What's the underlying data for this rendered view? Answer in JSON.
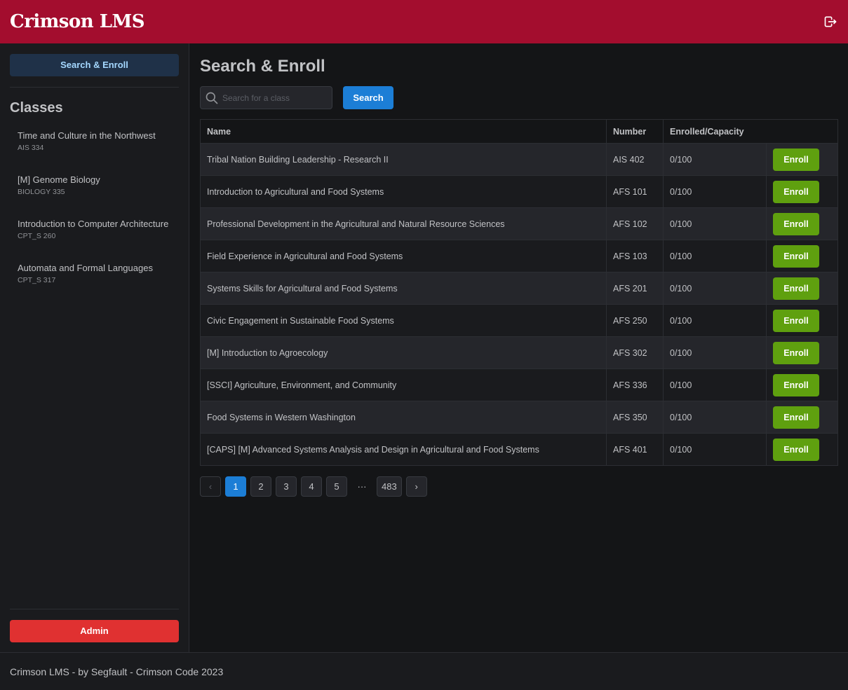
{
  "header": {
    "brand": "Crimson LMS",
    "logout_icon": "logout-icon"
  },
  "sidebar": {
    "nav_button": "Search & Enroll",
    "classes_title": "Classes",
    "classes": [
      {
        "name": "Time and Culture in the Northwest",
        "code": "AIS 334"
      },
      {
        "name": "[M] Genome Biology",
        "code": "BIOLOGY 335"
      },
      {
        "name": "Introduction to Computer Architecture",
        "code": "CPT_S 260"
      },
      {
        "name": "Automata and Formal Languages",
        "code": "CPT_S 317"
      }
    ],
    "admin_button": "Admin"
  },
  "main": {
    "title": "Search & Enroll",
    "search": {
      "placeholder": "Search for a class",
      "value": "",
      "button": "Search"
    },
    "table": {
      "headers": {
        "name": "Name",
        "number": "Number",
        "capacity": "Enrolled/Capacity"
      },
      "enroll_label": "Enroll",
      "rows": [
        {
          "name": "Tribal Nation Building Leadership - Research II",
          "number": "AIS 402",
          "capacity": "0/100"
        },
        {
          "name": "Introduction to Agricultural and Food Systems",
          "number": "AFS 101",
          "capacity": "0/100"
        },
        {
          "name": "Professional Development in the Agricultural and Natural Resource Sciences",
          "number": "AFS 102",
          "capacity": "0/100"
        },
        {
          "name": "Field Experience in Agricultural and Food Systems",
          "number": "AFS 103",
          "capacity": "0/100"
        },
        {
          "name": "Systems Skills for Agricultural and Food Systems",
          "number": "AFS 201",
          "capacity": "0/100"
        },
        {
          "name": "Civic Engagement in Sustainable Food Systems",
          "number": "AFS 250",
          "capacity": "0/100"
        },
        {
          "name": "[M] Introduction to Agroecology",
          "number": "AFS 302",
          "capacity": "0/100"
        },
        {
          "name": "[SSCI] Agriculture, Environment, and Community",
          "number": "AFS 336",
          "capacity": "0/100"
        },
        {
          "name": "Food Systems in Western Washington",
          "number": "AFS 350",
          "capacity": "0/100"
        },
        {
          "name": "[CAPS] [M] Advanced Systems Analysis and Design in Agricultural and Food Systems",
          "number": "AFS 401",
          "capacity": "0/100"
        }
      ]
    },
    "pagination": {
      "prev": "‹",
      "pages": [
        "1",
        "2",
        "3",
        "4",
        "5"
      ],
      "dots": "···",
      "last": "483",
      "next": "›",
      "active": "1"
    }
  },
  "footer": {
    "text": "Crimson LMS - by Segfault - Crimson Code 2023"
  },
  "colors": {
    "brand": "#a30d2e",
    "primary": "#1c7ed6",
    "enroll": "#5fa00f",
    "admin": "#e03131"
  }
}
